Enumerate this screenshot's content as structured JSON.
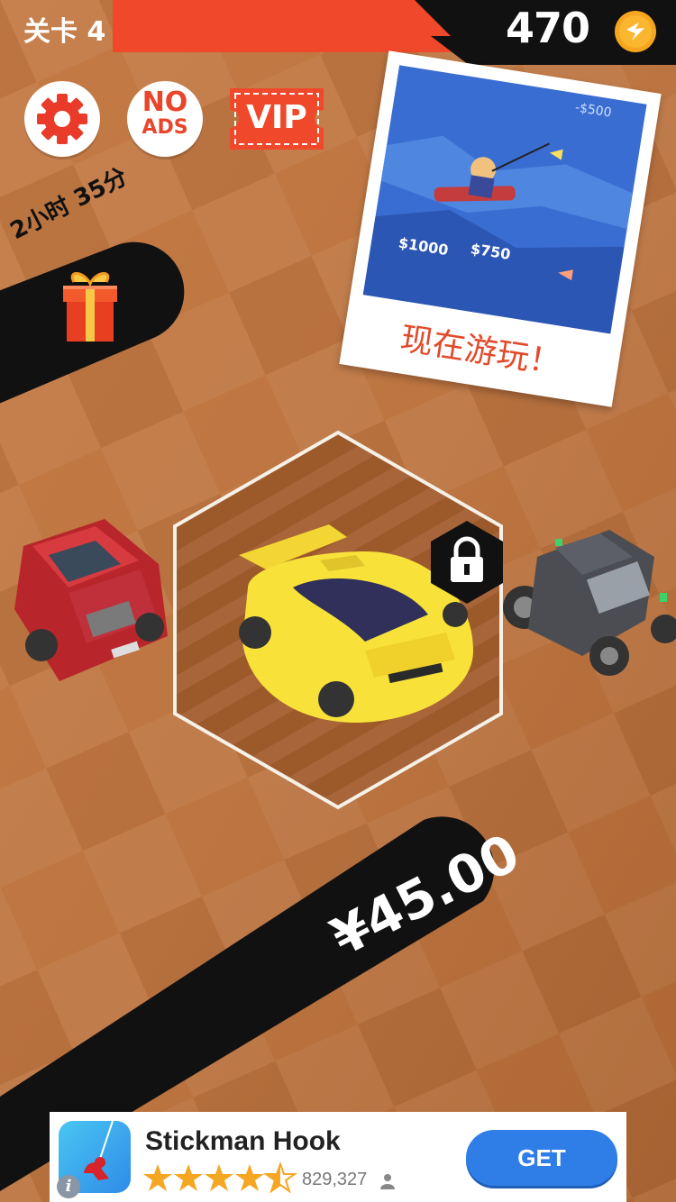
{
  "header": {
    "level_label": "关卡 4",
    "coin_count": "470",
    "coin_icon": "coin-lightning-icon"
  },
  "buttons": {
    "settings_icon": "gear-icon",
    "noads_line1": "NO",
    "noads_line2": "ADS",
    "vip_label": "VIP"
  },
  "gift": {
    "timer_text": "2小时 35分",
    "icon": "gift-box-icon"
  },
  "promo": {
    "caption": "现在游玩！",
    "image_labels": [
      "-$500",
      "$1000",
      "$750"
    ]
  },
  "cars": {
    "left": "red-pickup-truck",
    "center": "yellow-sports-car",
    "right": "gray-hot-rod",
    "locked": true,
    "price": "¥45.00"
  },
  "ad": {
    "app_name": "Stickman Hook",
    "rating_stars": 4.5,
    "rating_count": "829,327",
    "get_label": "GET",
    "info_label": "i"
  },
  "colors": {
    "accent_red": "#f0482a",
    "background": "#b96f3a",
    "get_button": "#2f7ee8",
    "star": "#f5a623"
  }
}
